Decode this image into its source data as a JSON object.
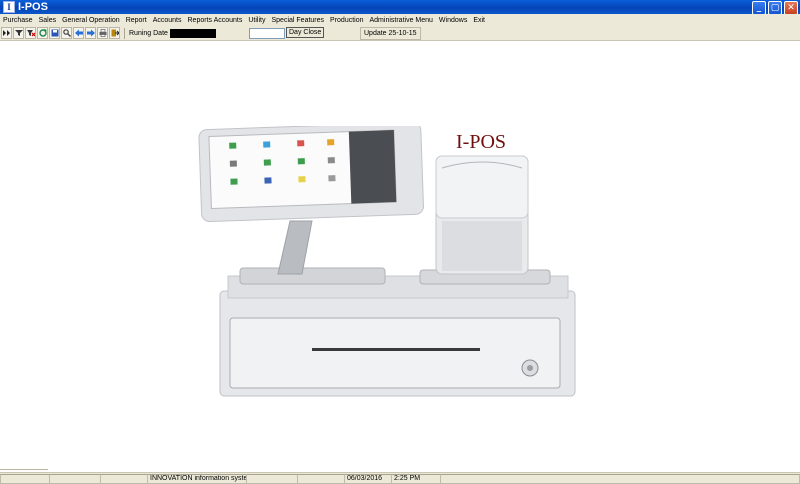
{
  "window": {
    "title": "I-POS",
    "app_icon_letter": "I"
  },
  "window_controls": {
    "minimize": "_",
    "maximize": "▢",
    "close": "✕"
  },
  "menu": [
    "Purchase",
    "Sales",
    "General Operation",
    "Report",
    "Accounts",
    "Reports Accounts",
    "Utility",
    "Special Features",
    "Production",
    "Administrative Menu",
    "Windows",
    "Exit"
  ],
  "toolbar": {
    "icons": [
      "first-icon",
      "filter-icon",
      "clear-filter-icon",
      "refresh-icon",
      "save-icon",
      "find-icon",
      "back-icon",
      "forward-icon",
      "print-icon",
      "exit-icon"
    ],
    "running_date_label": "Runing Date",
    "running_date_value": "",
    "day_close_input": "",
    "day_close_button": "Day Close",
    "update_label": "Update 25-10-15"
  },
  "main": {
    "brand_title": "I-POS",
    "brand_color": "#6e1010"
  },
  "statusbar": {
    "company": "INNOVATION information system",
    "date": "06/03/2016",
    "time": "2:25 PM"
  }
}
